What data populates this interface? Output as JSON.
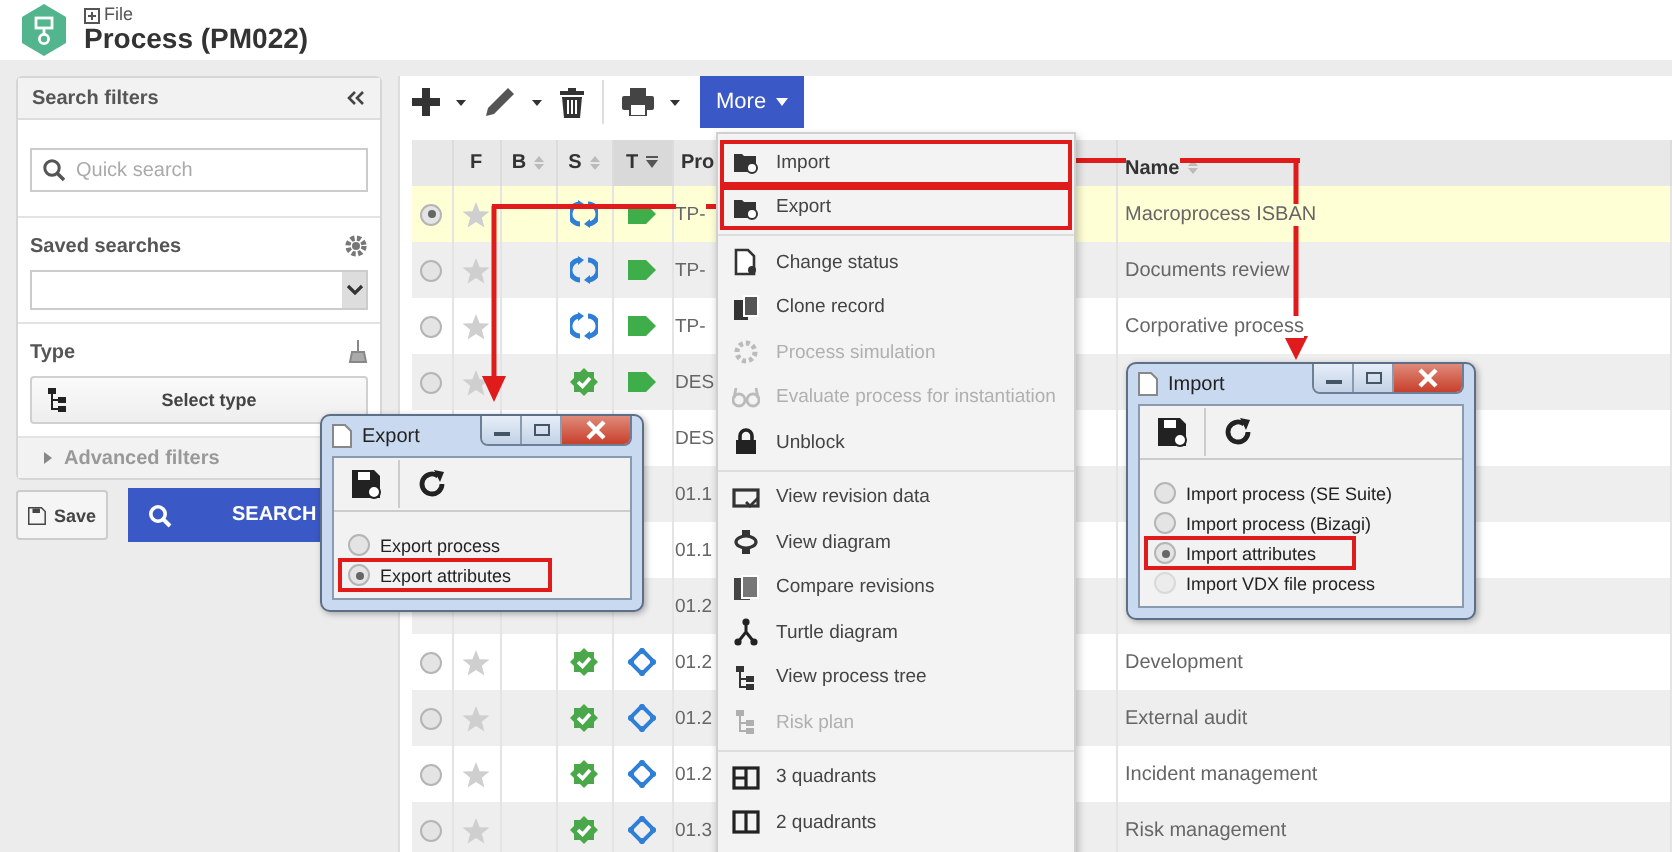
{
  "header": {
    "breadcrumb": "File",
    "title": "Process (PM022)"
  },
  "filters": {
    "title": "Search filters",
    "quick_search": {
      "placeholder": "Quick search"
    },
    "saved_searches": {
      "label": "Saved searches"
    },
    "type": {
      "label": "Type",
      "button": "Select type"
    },
    "advanced": {
      "label": "Advanced filters",
      "expanded": false
    },
    "save_button": "Save",
    "search_button": "SEARCH"
  },
  "toolbar": {
    "more_button": "More"
  },
  "table": {
    "columns": [
      {
        "label": "F"
      },
      {
        "label": "B",
        "sortable": true,
        "sorted": false
      },
      {
        "label": "S",
        "sortable": true,
        "sorted": false
      },
      {
        "label": "T",
        "sorted": true
      },
      {
        "label": "Pro"
      },
      {
        "label": "Name",
        "sortable": true,
        "sorted": false
      }
    ],
    "rows": [
      {
        "selected": true,
        "code": "TP-",
        "name": "Macroprocess ISBAN",
        "status": {
          "kind": "cycle"
        },
        "type": {
          "kind": "tag"
        }
      },
      {
        "selected": false,
        "code": "TP-",
        "name": "Documents review",
        "status": {
          "kind": "cycle"
        },
        "type": {
          "kind": "tag"
        }
      },
      {
        "selected": false,
        "code": "TP-",
        "name": "Corporative process",
        "status": {
          "kind": "cycle"
        },
        "type": {
          "kind": "tag"
        }
      },
      {
        "selected": false,
        "code": "DES",
        "status": {
          "kind": "approved"
        },
        "type": {
          "kind": "tag"
        }
      },
      {
        "code": "DES"
      },
      {
        "code": "01.1"
      },
      {
        "code": "01.1"
      },
      {
        "code": "01.2"
      },
      {
        "selected": false,
        "code": "01.2",
        "name": "Development",
        "status": {
          "kind": "approved"
        },
        "type": {
          "kind": "diamond"
        }
      },
      {
        "selected": false,
        "code": "01.2",
        "name": "External audit",
        "status": {
          "kind": "approved"
        },
        "type": {
          "kind": "diamond"
        }
      },
      {
        "selected": false,
        "code": "01.2",
        "name": "Incident management",
        "status": {
          "kind": "approved"
        },
        "type": {
          "kind": "diamond"
        }
      },
      {
        "selected": false,
        "code": "01.3",
        "name": "Risk management",
        "status": {
          "kind": "approved"
        },
        "type": {
          "kind": "diamond"
        }
      }
    ]
  },
  "menu": {
    "groups": [
      [
        {
          "label": "Import",
          "disabled": false,
          "highlighted": true
        },
        {
          "label": "Export",
          "disabled": false,
          "highlighted": true
        }
      ],
      [
        {
          "label": "Change status",
          "disabled": false,
          "highlighted": false
        },
        {
          "label": "Clone record",
          "disabled": false,
          "highlighted": false
        },
        {
          "label": "Process simulation",
          "disabled": true,
          "highlighted": false
        },
        {
          "label": "Evaluate process for instantiation",
          "disabled": true,
          "highlighted": false
        },
        {
          "label": "Unblock",
          "disabled": false,
          "highlighted": false
        }
      ],
      [
        {
          "label": "View revision data",
          "disabled": false,
          "highlighted": false
        },
        {
          "label": "View diagram",
          "disabled": false,
          "highlighted": false
        },
        {
          "label": "Compare revisions",
          "disabled": false,
          "highlighted": false
        },
        {
          "label": "Turtle diagram",
          "disabled": false,
          "highlighted": false
        },
        {
          "label": "View process tree",
          "disabled": false,
          "highlighted": false
        },
        {
          "label": "Risk plan",
          "disabled": true,
          "highlighted": false
        }
      ],
      [
        {
          "label": "3 quadrants",
          "disabled": false,
          "highlighted": false
        },
        {
          "label": "2 quadrants",
          "disabled": false,
          "highlighted": false
        }
      ]
    ]
  },
  "export_dialog": {
    "title": "Export",
    "options": [
      {
        "label": "Export process",
        "selected": false,
        "highlighted": false,
        "disabled": false
      },
      {
        "label": "Export attributes",
        "selected": true,
        "highlighted": true,
        "disabled": false
      }
    ]
  },
  "import_dialog": {
    "title": "Import",
    "options": [
      {
        "label": "Import process (SE Suite)",
        "selected": false,
        "highlighted": false,
        "disabled": false
      },
      {
        "label": "Import process (Bizagi)",
        "selected": false,
        "highlighted": false,
        "disabled": false
      },
      {
        "label": "Import attributes",
        "selected": true,
        "highlighted": true,
        "disabled": false
      },
      {
        "label": "Import VDX file process",
        "selected": false,
        "highlighted": false,
        "disabled": true
      }
    ]
  }
}
